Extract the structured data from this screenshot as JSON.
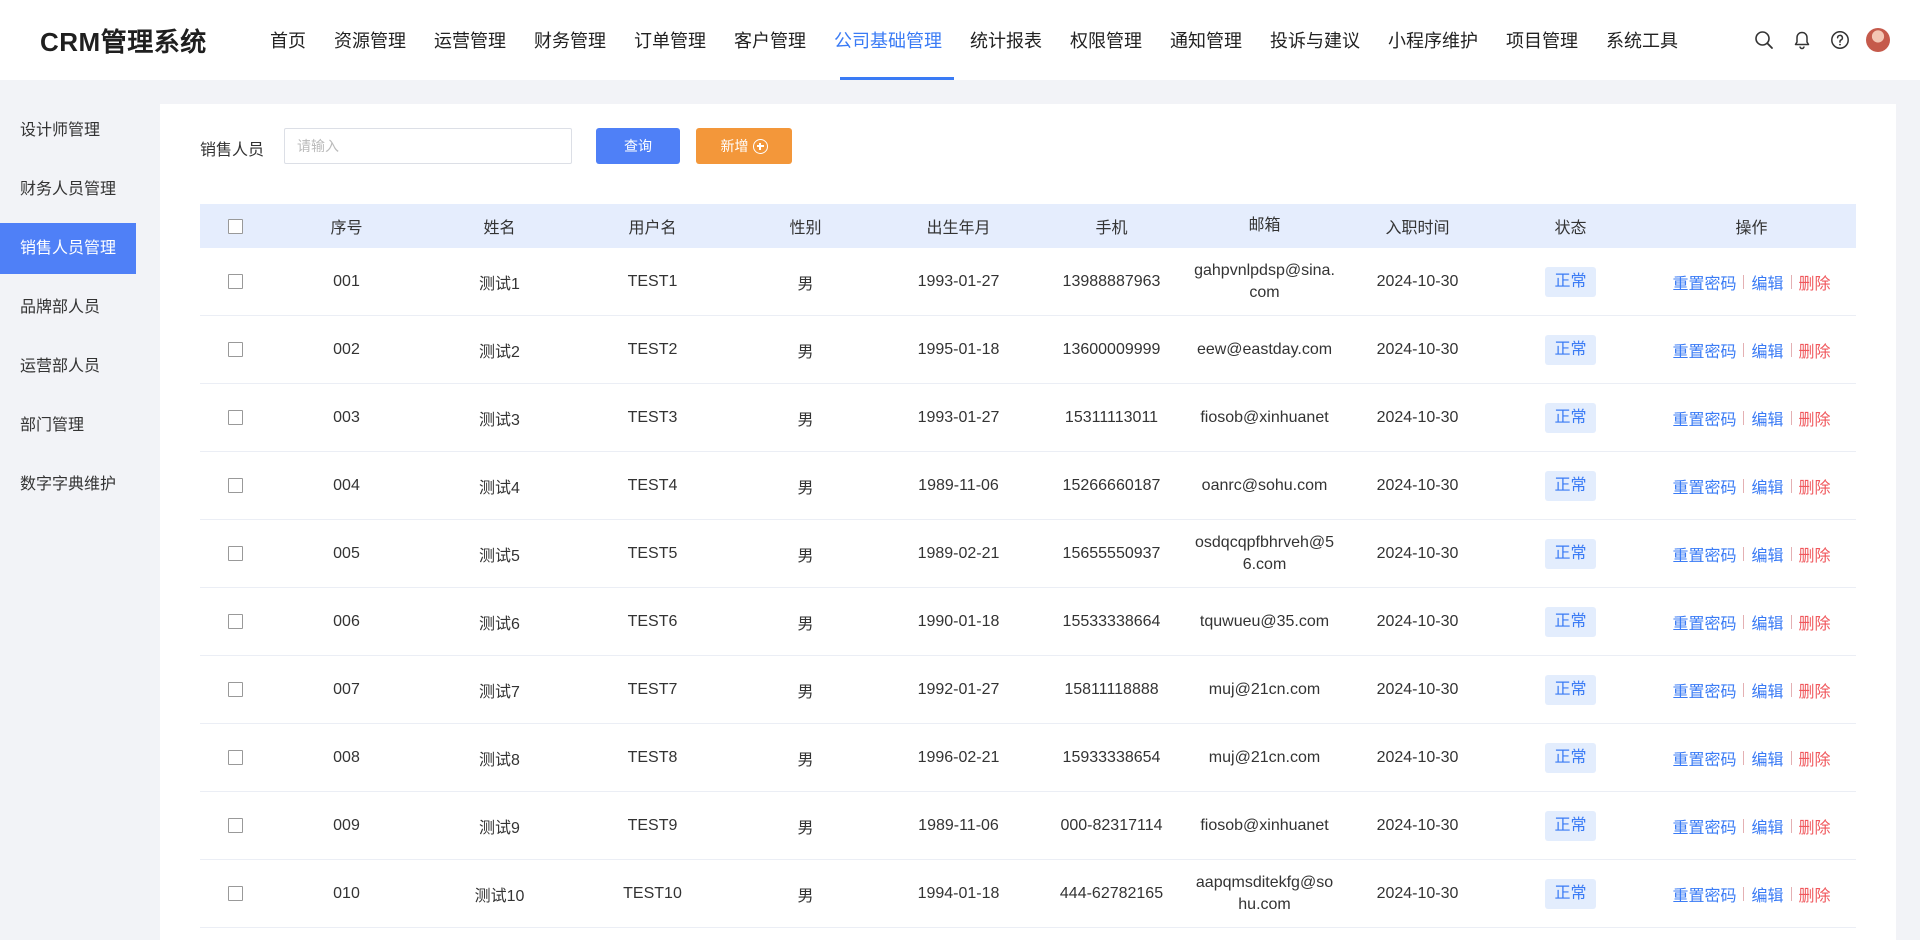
{
  "header": {
    "logo": "CRM管理系统",
    "nav": [
      {
        "label": "首页",
        "active": false
      },
      {
        "label": "资源管理",
        "active": false
      },
      {
        "label": "运营管理",
        "active": false
      },
      {
        "label": "财务管理",
        "active": false
      },
      {
        "label": "订单管理",
        "active": false
      },
      {
        "label": "客户管理",
        "active": false
      },
      {
        "label": "公司基础管理",
        "active": true
      },
      {
        "label": "统计报表",
        "active": false
      },
      {
        "label": "权限管理",
        "active": false
      },
      {
        "label": "通知管理",
        "active": false
      },
      {
        "label": "投诉与建议",
        "active": false
      },
      {
        "label": "小程序维护",
        "active": false
      },
      {
        "label": "项目管理",
        "active": false
      },
      {
        "label": "系统工具",
        "active": false
      }
    ],
    "icons": [
      "search-icon",
      "bell-icon",
      "help-icon",
      "avatar"
    ]
  },
  "sidebar": {
    "items": [
      {
        "label": "设计师管理",
        "active": false
      },
      {
        "label": "财务人员管理",
        "active": false
      },
      {
        "label": "销售人员管理",
        "active": true
      },
      {
        "label": "品牌部人员",
        "active": false
      },
      {
        "label": "运营部人员",
        "active": false
      },
      {
        "label": "部门管理",
        "active": false
      },
      {
        "label": "数字字典维护",
        "active": false
      }
    ]
  },
  "search": {
    "label": "销售人员",
    "placeholder": "请输入",
    "value": "",
    "query_label": "查询",
    "add_label": "新增"
  },
  "colors": {
    "accent": "#3a7bf5",
    "primary_button": "#4f80f7",
    "add_button": "#f3973a",
    "delete": "#f0575c",
    "table_header": "#e5edfd"
  },
  "table": {
    "columns": [
      "序号",
      "姓名",
      "用户名",
      "性别",
      "出生年月",
      "手机",
      "邮箱",
      "入职时间",
      "状态",
      "操作"
    ],
    "actions": {
      "reset": "重置密码",
      "edit": "编辑",
      "delete": "删除"
    },
    "rows": [
      {
        "idx": "001",
        "name": "测试1",
        "username": "TEST1",
        "sex": "男",
        "birth": "1993-01-27",
        "phone": "13988887963",
        "email": "gahpvnlpdsp@sina.com",
        "hired": "2024-10-30",
        "status": "正常"
      },
      {
        "idx": "002",
        "name": "测试2",
        "username": "TEST2",
        "sex": "男",
        "birth": "1995-01-18",
        "phone": "13600009999",
        "email": "eew@eastday.com",
        "hired": "2024-10-30",
        "status": "正常"
      },
      {
        "idx": "003",
        "name": "测试3",
        "username": "TEST3",
        "sex": "男",
        "birth": "1993-01-27",
        "phone": "15311113011",
        "email": "fiosob@xinhuanet",
        "hired": "2024-10-30",
        "status": "正常"
      },
      {
        "idx": "004",
        "name": "测试4",
        "username": "TEST4",
        "sex": "男",
        "birth": "1989-11-06",
        "phone": "15266660187",
        "email": "oanrc@sohu.com",
        "hired": "2024-10-30",
        "status": "正常"
      },
      {
        "idx": "005",
        "name": "测试5",
        "username": "TEST5",
        "sex": "男",
        "birth": "1989-02-21",
        "phone": "15655550937",
        "email": "osdqcqpfbhrveh@56.com",
        "hired": "2024-10-30",
        "status": "正常"
      },
      {
        "idx": "006",
        "name": "测试6",
        "username": "TEST6",
        "sex": "男",
        "birth": "1990-01-18",
        "phone": "15533338664",
        "email": "tquwueu@35.com",
        "hired": "2024-10-30",
        "status": "正常"
      },
      {
        "idx": "007",
        "name": "测试7",
        "username": "TEST7",
        "sex": "男",
        "birth": "1992-01-27",
        "phone": "15811118888",
        "email": "muj@21cn.com",
        "hired": "2024-10-30",
        "status": "正常"
      },
      {
        "idx": "008",
        "name": "测试8",
        "username": "TEST8",
        "sex": "男",
        "birth": "1996-02-21",
        "phone": "15933338654",
        "email": "muj@21cn.com",
        "hired": "2024-10-30",
        "status": "正常"
      },
      {
        "idx": "009",
        "name": "测试9",
        "username": "TEST9",
        "sex": "男",
        "birth": "1989-11-06",
        "phone": "000-82317114",
        "email": "fiosob@xinhuanet",
        "hired": "2024-10-30",
        "status": "正常"
      },
      {
        "idx": "010",
        "name": "测试10",
        "username": "TEST10",
        "sex": "男",
        "birth": "1994-01-18",
        "phone": "444-62782165",
        "email": "aapqmsditekfg@sohu.com",
        "hired": "2024-10-30",
        "status": "正常"
      }
    ]
  }
}
